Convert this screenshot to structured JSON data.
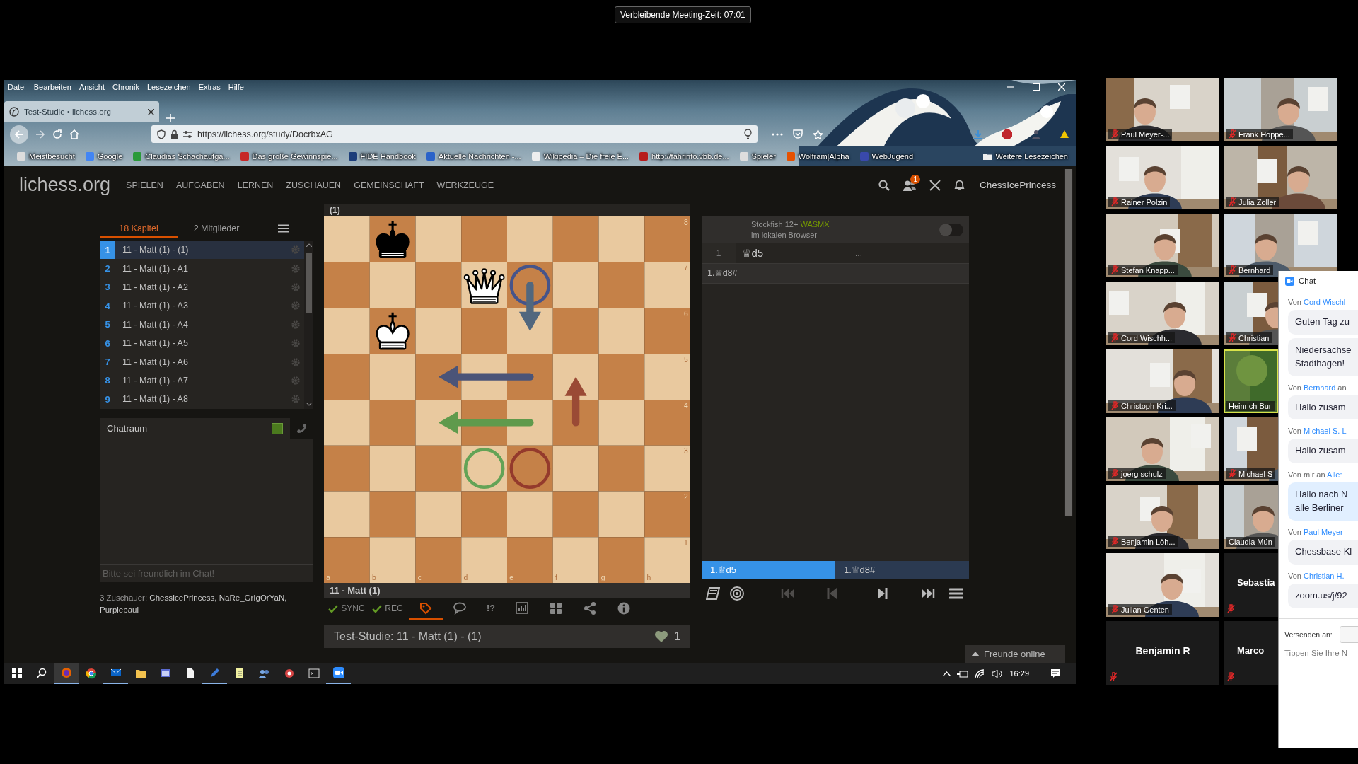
{
  "meeting_timer": "Verbleibende Meeting-Zeit: 07:01",
  "browser": {
    "menu": [
      "Datei",
      "Bearbeiten",
      "Ansicht",
      "Chronik",
      "Lesezeichen",
      "Extras",
      "Hilfe"
    ],
    "tab_title": "Test-Studie • lichess.org",
    "url": "https://lichess.org/study/DocrbxAG",
    "bookmarks": [
      "Meistbesucht",
      "Google",
      "Claudias Schachaufga...",
      "Das große Gewinnspie...",
      "FIDE Handbook",
      "Aktuelle Nachrichten -...",
      "Wikipedia – Die freie E...",
      "http://fahrinfo.vbb.de...",
      "Spieler",
      "Wolfram|Alpha",
      "WebJugend",
      "Weitere Lesezeichen"
    ]
  },
  "lichess": {
    "logo": "lichess.org",
    "nav": [
      "SPIELEN",
      "AUFGABEN",
      "LERNEN",
      "ZUSCHAUEN",
      "GEMEINSCHAFT",
      "WERKZEUGE"
    ],
    "notification_count": "1",
    "user": "ChessIcePrincess",
    "study_tabs": [
      {
        "label": "18 Kapitel",
        "selected": true
      },
      {
        "label": "2 Mitglieder",
        "selected": false
      }
    ],
    "chapters": [
      {
        "number": "1",
        "title": "11 - Matt (1) - (1)",
        "selected": true
      },
      {
        "number": "2",
        "title": "11 - Matt (1) - A1",
        "selected": false
      },
      {
        "number": "3",
        "title": "11 - Matt (1) - A2",
        "selected": false
      },
      {
        "number": "4",
        "title": "11 - Matt (1) - A3",
        "selected": false
      },
      {
        "number": "5",
        "title": "11 - Matt (1) - A4",
        "selected": false
      },
      {
        "number": "6",
        "title": "11 - Matt (1) - A5",
        "selected": false
      },
      {
        "number": "7",
        "title": "11 - Matt (1) - A6",
        "selected": false
      },
      {
        "number": "8",
        "title": "11 - Matt (1) - A7",
        "selected": false
      },
      {
        "number": "9",
        "title": "11 - Matt (1) - A8",
        "selected": false
      }
    ],
    "chatroom": {
      "title": "Chatraum",
      "enabled": true,
      "placeholder": "Bitte sei freundlich im Chat!"
    },
    "spectators": {
      "label": "3 Zuschauer:",
      "names": "ChessIcePrincess, NaRe_GrIgOrYaN, Purplepaul"
    },
    "board": {
      "title": "(1)",
      "files": [
        "a",
        "b",
        "c",
        "d",
        "e",
        "f",
        "g",
        "h"
      ],
      "ranks": [
        "8",
        "7",
        "6",
        "5",
        "4",
        "3",
        "2",
        "1"
      ],
      "squares": [
        [
          {
            "kind": "empty"
          },
          {
            "kind": "king",
            "black": true
          },
          {
            "kind": "empty"
          },
          {
            "kind": "empty"
          },
          {
            "kind": "empty"
          },
          {
            "kind": "empty"
          },
          {
            "kind": "empty"
          },
          {
            "kind": "empty"
          }
        ],
        [
          {
            "kind": "empty"
          },
          {
            "kind": "empty"
          },
          {
            "kind": "empty"
          },
          {
            "kind": "queen",
            "black": false
          },
          {
            "kind": "empty",
            "circle": {
              "color": "#46548a"
            },
            "arrow": {
              "kind": "down",
              "long": false,
              "color": "#51677e"
            }
          },
          {
            "kind": "empty"
          },
          {
            "kind": "empty"
          },
          {
            "kind": "empty"
          }
        ],
        [
          {
            "kind": "empty"
          },
          {
            "kind": "king",
            "black": false
          },
          {
            "kind": "empty"
          },
          {
            "kind": "empty"
          },
          {
            "kind": "empty"
          },
          {
            "kind": "empty"
          },
          {
            "kind": "empty"
          },
          {
            "kind": "empty"
          }
        ],
        [
          {
            "kind": "empty"
          },
          {
            "kind": "empty"
          },
          {
            "kind": "empty"
          },
          {
            "kind": "empty"
          },
          {
            "kind": "empty",
            "arrow": {
              "kind": "left",
              "long": true,
              "color": "#4b5478"
            }
          },
          {
            "kind": "empty"
          },
          {
            "kind": "empty"
          },
          {
            "kind": "empty"
          }
        ],
        [
          {
            "kind": "empty"
          },
          {
            "kind": "empty"
          },
          {
            "kind": "empty"
          },
          {
            "kind": "empty"
          },
          {
            "kind": "empty",
            "arrow": {
              "kind": "left",
              "long": true,
              "color": "#5f9a4c"
            }
          },
          {
            "kind": "empty",
            "arrow": {
              "kind": "up",
              "long": false,
              "color": "#9a4a35"
            }
          },
          {
            "kind": "empty"
          },
          {
            "kind": "empty"
          }
        ],
        [
          {
            "kind": "empty"
          },
          {
            "kind": "empty"
          },
          {
            "kind": "empty"
          },
          {
            "kind": "empty",
            "circle": {
              "color": "#63a356"
            }
          },
          {
            "kind": "empty",
            "circle": {
              "color": "#943a2c"
            }
          },
          {
            "kind": "empty"
          },
          {
            "kind": "empty"
          },
          {
            "kind": "empty"
          }
        ],
        [
          {
            "kind": "empty"
          },
          {
            "kind": "empty"
          },
          {
            "kind": "empty"
          },
          {
            "kind": "empty"
          },
          {
            "kind": "empty"
          },
          {
            "kind": "empty"
          },
          {
            "kind": "empty"
          },
          {
            "kind": "empty"
          }
        ],
        [
          {
            "kind": "empty"
          },
          {
            "kind": "empty"
          },
          {
            "kind": "empty"
          },
          {
            "kind": "empty"
          },
          {
            "kind": "empty"
          },
          {
            "kind": "empty"
          },
          {
            "kind": "empty"
          },
          {
            "kind": "empty"
          }
        ]
      ]
    },
    "chapter_name": "11 - Matt (1)",
    "tools": [
      {
        "kind": "sync",
        "label": "SYNC",
        "selected": false
      },
      {
        "kind": "rec",
        "label": "REC",
        "selected": false
      },
      {
        "kind": "tags",
        "selected": true
      },
      {
        "kind": "comments",
        "selected": false
      },
      {
        "kind": "glyphs",
        "label": "!?",
        "selected": false
      },
      {
        "kind": "chart",
        "selected": false
      },
      {
        "kind": "grid",
        "selected": false
      },
      {
        "kind": "share",
        "selected": false
      },
      {
        "kind": "info",
        "selected": false
      }
    ],
    "study_title": "Test-Studie: 11 - Matt (1) - (1)",
    "likes": "1",
    "engine": {
      "name": "Stockfish 12+",
      "tag": "WASMX",
      "location": "im lokalen Browser",
      "on": false
    },
    "moves": [
      {
        "number": "1",
        "move": "♕d5",
        "reply": "..."
      }
    ],
    "variation": "1.♕d8#",
    "move_tabs": [
      {
        "label": "1.♕d5",
        "selected": true
      },
      {
        "label": "1.♕d8#",
        "selected": false
      }
    ],
    "controls": [
      {
        "kind": "book",
        "disabled": false
      },
      {
        "kind": "practice",
        "disabled": false
      },
      {
        "kind": "first",
        "disabled": true
      },
      {
        "kind": "prev",
        "disabled": true
      },
      {
        "kind": "next",
        "disabled": false
      },
      {
        "kind": "last",
        "disabled": false
      },
      {
        "kind": "menu",
        "disabled": false
      }
    ],
    "friends_button": "Freunde online"
  },
  "taskbar": {
    "time": "16:29"
  },
  "participants": [
    {
      "name": "Paul Meyer-...",
      "video": true,
      "muted": true,
      "speaking": false
    },
    {
      "name": "Frank Hoppe...",
      "video": true,
      "muted": true,
      "speaking": false
    },
    {
      "name": "Rainer Polzin",
      "video": true,
      "muted": true,
      "speaking": false
    },
    {
      "name": "Julia Zoller",
      "video": true,
      "muted": true,
      "speaking": false
    },
    {
      "name": "Stefan Knapp...",
      "video": true,
      "muted": true,
      "speaking": false
    },
    {
      "name": "Bernhard",
      "video": true,
      "muted": true,
      "speaking": false
    },
    {
      "name": "Cord Wischh...",
      "video": true,
      "muted": true,
      "speaking": false
    },
    {
      "name": "Christian",
      "video": true,
      "muted": true,
      "speaking": false
    },
    {
      "name": "Christoph Kri...",
      "video": true,
      "muted": true,
      "speaking": false
    },
    {
      "name": "Heinrich Bur",
      "video": true,
      "muted": false,
      "speaking": true
    },
    {
      "name": "joerg schulz",
      "video": true,
      "muted": true,
      "speaking": false
    },
    {
      "name": "Michael S",
      "video": true,
      "muted": true,
      "speaking": false
    },
    {
      "name": "Benjamin Löh...",
      "video": true,
      "muted": true,
      "speaking": false
    },
    {
      "name": "Claudia Mün",
      "video": true,
      "muted": false,
      "speaking": false
    },
    {
      "name": "Julian Genten",
      "video": true,
      "muted": true,
      "speaking": false
    },
    {
      "name": "Sebastia",
      "video": false,
      "muted": true,
      "speaking": false
    },
    {
      "name": "Benjamin R",
      "video": false,
      "muted": true,
      "speaking": false
    },
    {
      "name": "Marco",
      "video": false,
      "muted": true,
      "speaking": false
    }
  ],
  "chat": {
    "title": "Chat",
    "messages": [
      {
        "prefix": "Von",
        "sender": "Cord Wischl",
        "bubbles": [
          [
            "Guten Tag zu"
          ],
          [
            "Niedersachse",
            "Stadthagen!"
          ]
        ],
        "mine": false
      },
      {
        "prefix": "Von",
        "sender": "Bernhard",
        "suffix": "an",
        "bubbles": [
          [
            "Hallo zusam"
          ]
        ],
        "mine": false
      },
      {
        "prefix": "Von",
        "sender": "Michael S. L",
        "bubbles": [
          [
            "Hallo zusam"
          ]
        ],
        "mine": false
      },
      {
        "prefix": "Von mir an",
        "sender": "Alle:",
        "bubbles": [
          [
            "Hallo nach N",
            "alle Berliner"
          ]
        ],
        "mine": true
      },
      {
        "prefix": "Von",
        "sender": "Paul Meyer-",
        "bubbles": [
          [
            "Chessbase Kl"
          ]
        ],
        "mine": false
      },
      {
        "prefix": "Von",
        "sender": "Christian H.",
        "bubbles": [
          [
            "zoom.us/j/92"
          ]
        ],
        "mine": false
      }
    ],
    "send_to_label": "Versenden an:",
    "placeholder": "Tippen Sie Ihre N"
  }
}
